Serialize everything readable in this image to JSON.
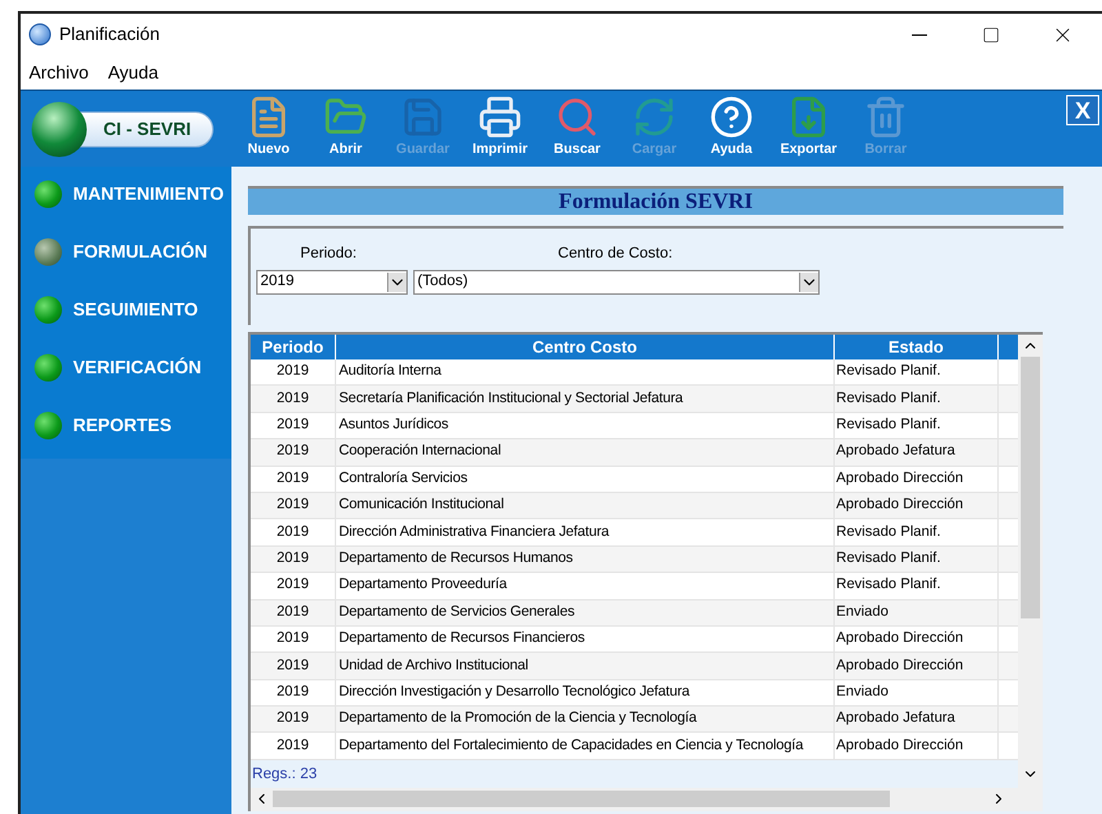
{
  "window": {
    "title": "Planificación"
  },
  "menu": [
    "Archivo",
    "Ayuda"
  ],
  "logo": {
    "label": "CI - SEVRI"
  },
  "toolbar": [
    {
      "kind": "nuevo",
      "label": "Nuevo",
      "disabled": false
    },
    {
      "kind": "abrir",
      "label": "Abrir",
      "disabled": false
    },
    {
      "kind": "guardar",
      "label": "Guardar",
      "disabled": true
    },
    {
      "kind": "imprimir",
      "label": "Imprimir",
      "disabled": false
    },
    {
      "kind": "buscar",
      "label": "Buscar",
      "disabled": false
    },
    {
      "kind": "cargar",
      "label": "Cargar",
      "disabled": true
    },
    {
      "kind": "ayuda",
      "label": "Ayuda",
      "disabled": false
    },
    {
      "kind": "exportar",
      "label": "Exportar",
      "disabled": false
    },
    {
      "kind": "borrar",
      "label": "Borrar",
      "disabled": true
    }
  ],
  "close_button": {
    "label": "X"
  },
  "sidebar": {
    "items": [
      {
        "label": "MANTENIMIENTO",
        "selected": false
      },
      {
        "label": "FORMULACIÓN",
        "selected": true
      },
      {
        "label": "SEGUIMIENTO",
        "selected": false
      },
      {
        "label": "VERIFICACIÓN",
        "selected": false
      },
      {
        "label": "REPORTES",
        "selected": false
      }
    ]
  },
  "panel": {
    "title": "Formulación SEVRI",
    "filters": {
      "periodo": {
        "label": "Periodo:",
        "value": "2019"
      },
      "centro": {
        "label": "Centro de Costo:",
        "value": "(Todos)"
      }
    },
    "table": {
      "columns": [
        "Periodo",
        "Centro Costo",
        "Estado"
      ],
      "rows": [
        [
          "2019",
          "Auditoría Interna",
          "Revisado Planif."
        ],
        [
          "2019",
          "Secretaría Planificación Institucional y Sectorial Jefatura",
          "Revisado Planif."
        ],
        [
          "2019",
          "Asuntos Jurídicos",
          "Revisado Planif."
        ],
        [
          "2019",
          "Cooperación Internacional",
          "Aprobado Jefatura"
        ],
        [
          "2019",
          "Contraloría Servicios",
          "Aprobado Dirección"
        ],
        [
          "2019",
          "Comunicación Institucional",
          "Aprobado Dirección"
        ],
        [
          "2019",
          "Dirección Administrativa Financiera Jefatura",
          "Revisado Planif."
        ],
        [
          "2019",
          "Departamento de Recursos Humanos",
          "Revisado Planif."
        ],
        [
          "2019",
          "Departamento Proveeduría",
          "Revisado Planif."
        ],
        [
          "2019",
          "Departamento de Servicios Generales",
          "Enviado"
        ],
        [
          "2019",
          "Departamento de Recursos Financieros",
          "Aprobado Dirección"
        ],
        [
          "2019",
          "Unidad de Archivo Institucional",
          "Aprobado Dirección"
        ],
        [
          "2019",
          "Dirección Investigación y Desarrollo Tecnológico Jefatura",
          "Enviado"
        ],
        [
          "2019",
          "Departamento de la Promoción de la Ciencia y Tecnología",
          "Aprobado Jefatura"
        ],
        [
          "2019",
          "Departamento del Fortalecimiento de Capacidades en Ciencia y Tecnología",
          "Aprobado Dirección"
        ]
      ],
      "footer": "Regs.: 23"
    }
  }
}
